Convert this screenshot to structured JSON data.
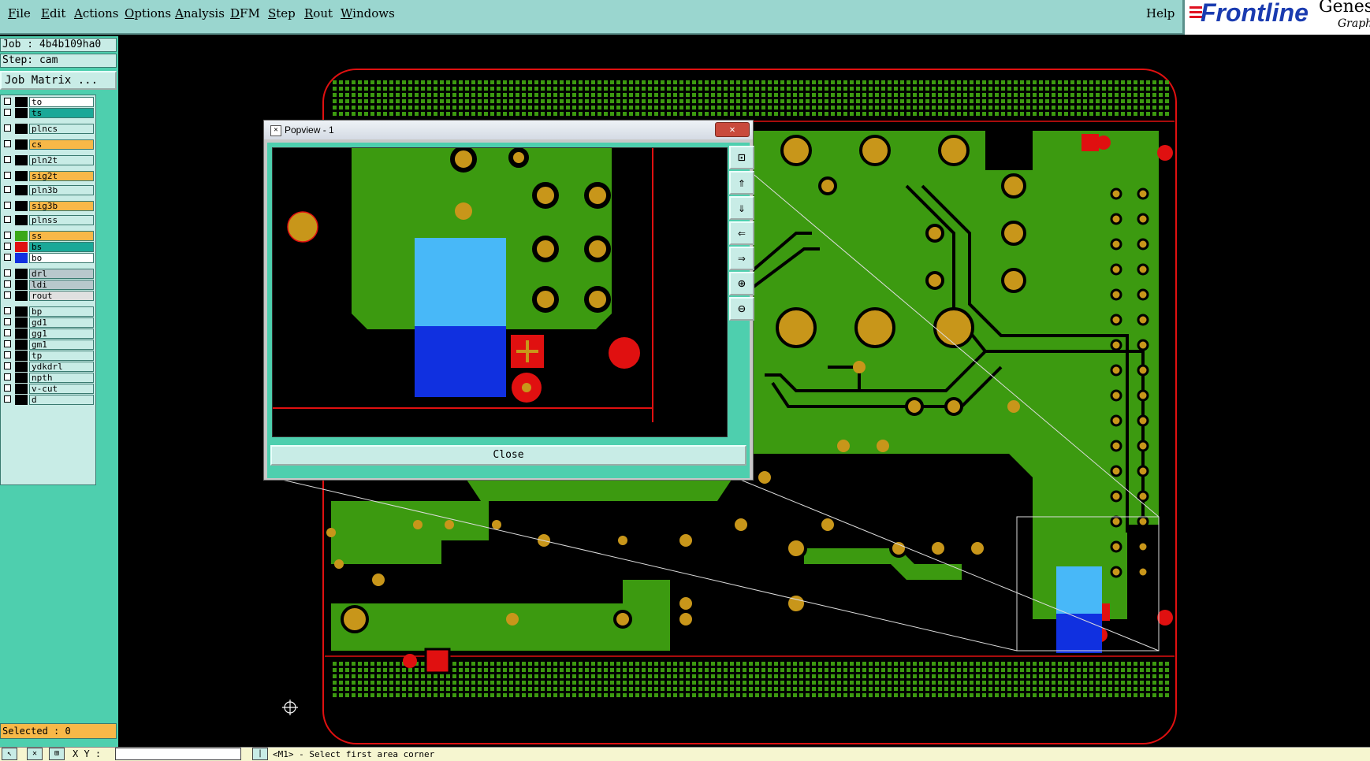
{
  "menu": {
    "file": "File",
    "edit": "Edit",
    "actions": "Actions",
    "options": "Options",
    "analysis": "Analysis",
    "dfm": "DFM",
    "step": "Step",
    "rout": "Rout",
    "windows": "Windows",
    "help": "Help"
  },
  "brand": {
    "logo": "Frontline",
    "product": "Genes",
    "tagline": "Graphi"
  },
  "job": {
    "job_line": "Job : 4b4b109ha0",
    "step_line": "Step: cam",
    "matrix_button": "Job Matrix ..."
  },
  "layers": [
    {
      "name": "to",
      "color": "#ffffff",
      "swatch": "#000000"
    },
    {
      "name": "ts",
      "color": "#1aa898",
      "swatch": "#000000"
    },
    {
      "name": "plncs",
      "color": "#c8ece6",
      "swatch": "#000000"
    },
    {
      "name": "cs",
      "color": "#f8b848",
      "swatch": "#000000"
    },
    {
      "name": "pln2t",
      "color": "#c8ece6",
      "swatch": "#000000"
    },
    {
      "name": "sig2t",
      "color": "#f8b848",
      "swatch": "#000000"
    },
    {
      "name": "pln3b",
      "color": "#c8ece6",
      "swatch": "#000000"
    },
    {
      "name": "sig3b",
      "color": "#f8b848",
      "swatch": "#000000"
    },
    {
      "name": "plnss",
      "color": "#c8ece6",
      "swatch": "#000000"
    },
    {
      "name": "ss",
      "color": "#f8b848",
      "swatch": "#3aa818"
    },
    {
      "name": "bs",
      "color": "#1aa898",
      "swatch": "#e01010"
    },
    {
      "name": "bo",
      "color": "#ffffff",
      "swatch": "#1030e0"
    },
    {
      "name": "drl",
      "color": "#b8c8cc",
      "swatch": "#000000"
    },
    {
      "name": "ldi",
      "color": "#b8c8cc",
      "swatch": "#000000"
    },
    {
      "name": "rout",
      "color": "#e0e0e0",
      "swatch": "#000000"
    },
    {
      "name": "bp",
      "color": "#c8ece6",
      "swatch": "#000000"
    },
    {
      "name": "gd1",
      "color": "#c8ece6",
      "swatch": "#000000"
    },
    {
      "name": "gg1",
      "color": "#c8ece6",
      "swatch": "#000000"
    },
    {
      "name": "gm1",
      "color": "#c8ece6",
      "swatch": "#000000"
    },
    {
      "name": "tp",
      "color": "#c8ece6",
      "swatch": "#000000"
    },
    {
      "name": "ydkdrl",
      "color": "#c8ece6",
      "swatch": "#000000"
    },
    {
      "name": "npth",
      "color": "#c8ece6",
      "swatch": "#000000"
    },
    {
      "name": "v-cut",
      "color": "#c8ece6",
      "swatch": "#000000"
    },
    {
      "name": "d",
      "color": "#c8ece6",
      "swatch": "#000000"
    }
  ],
  "status": {
    "selected": "Selected : 0",
    "xy_label": "X Y :",
    "message": "<M1> - Select first area corner"
  },
  "popview": {
    "title": "Popview - 1",
    "close_label": "Close",
    "tools": [
      "zoom-fit-icon",
      "pan-up-icon",
      "pan-down-icon",
      "pan-left-icon",
      "pan-right-icon",
      "zoom-in-icon",
      "zoom-out-icon"
    ]
  },
  "colors": {
    "board_green": "#3c9a10",
    "pad_gold": "#c8961a",
    "outline_red": "#e01010",
    "ui_teal": "#4ecfae",
    "highlight_blue": "#1030e0",
    "highlight_lightblue": "#48b8f8"
  }
}
